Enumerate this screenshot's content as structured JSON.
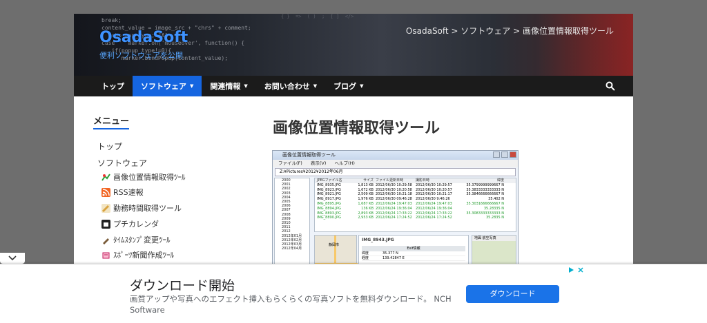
{
  "header": {
    "brand": "OsadaSoft",
    "tagline": "便利ソフトウェアを公開",
    "breadcrumb": "OsadaSoft > ソフトウェア > 画像位置情報取得ツール",
    "code_snippet": "break;\ncontent_value = image_src + \"chrs\" + comment;\n  echo map_type; \"A\"\ncase \"  marker.on('mouseover', function() {\n   if(popup_type!=0){\n      marker.bindPopup(content_value);"
  },
  "nav": {
    "items": [
      {
        "label": "トップ",
        "caret": ""
      },
      {
        "label": "ソフトウェア",
        "caret": "▼"
      },
      {
        "label": "関連情報",
        "caret": "▼"
      },
      {
        "label": "お問い合わせ",
        "caret": "▼"
      },
      {
        "label": "ブログ",
        "caret": "▼"
      }
    ]
  },
  "sidebar": {
    "title": "メニュー",
    "top_link": "トップ",
    "software_link": "ソフトウェア",
    "items": [
      {
        "label": "画像位置情報取得ﾂｰﾙ",
        "icon": "map-pin-icon",
        "color": "#2c9e3a"
      },
      {
        "label": "RSS速報",
        "icon": "rss-icon",
        "color": "#f26522"
      },
      {
        "label": "勤務時間取得ツール",
        "icon": "pencil-icon",
        "color": "#d9a441"
      },
      {
        "label": "プチカレンダ",
        "icon": "calendar-icon",
        "color": "#222222"
      },
      {
        "label": "ﾀｲﾑｽﾀﾝﾌﾟ変更ﾂｰﾙ",
        "icon": "pen-icon",
        "color": "#7a5c3a"
      },
      {
        "label": "ｽﾎﾟｰﾂ新聞作成ﾂｰﾙ",
        "icon": "newspaper-icon",
        "color": "#c2185b"
      }
    ]
  },
  "main": {
    "title": "画像位置情報取得ツール",
    "screenshot": {
      "window_title": "画像位置情報取得ツール",
      "menu": [
        "ファイル(F)",
        "表示(V)",
        "ヘルプ(H)"
      ],
      "path": "Z:¥Pictures¥2012¥2012年06月",
      "tree": [
        "2000",
        "2001",
        "2002",
        "2003",
        "2004",
        "2005",
        "2006",
        "2007",
        "2008",
        "2009",
        "2010",
        "2011",
        "2012",
        "2012年01月",
        "2012年02月",
        "2012年03月",
        "2012年04月"
      ],
      "columns": [
        "JPEGファイル名",
        "サイズ",
        "ファイル更新日時",
        "撮影日時",
        "緯度"
      ],
      "rows": [
        {
          "name": "IMG_8935.JPG",
          "size": "1,813 KB",
          "mtime": "2012/06/30 10:29:58",
          "shot": "2012/06/30 10:29:57",
          "lat": "35.3799999999667 N",
          "g": false
        },
        {
          "name": "IMG_8923.JPG",
          "size": "1,672 KB",
          "mtime": "2012/06/30 10:20:58",
          "shot": "2012/06/30 10:20:57",
          "lat": "35.3833333333333 N",
          "g": false
        },
        {
          "name": "IMG_8921.JPG",
          "size": "2,509 KB",
          "mtime": "2012/06/30 10:21:18",
          "shot": "2012/06/30 10:21:17",
          "lat": "35.3846666666667 N",
          "g": false
        },
        {
          "name": "IMG_8917.JPG",
          "size": "1,976 KB",
          "mtime": "2012/06/30 09:46:28",
          "shot": "2012/06/30 9:46:26",
          "lat": "35.402 N",
          "g": false
        },
        {
          "name": "IMG_8895.JPG",
          "size": "1,687 KB",
          "mtime": "2012/06/24 19:47:03",
          "shot": "2012/06/24 19:47:03",
          "lat": "35.3031666666667 N",
          "g": true
        },
        {
          "name": "IMG_8894.JPG",
          "size": "136 KB",
          "mtime": "2012/06/24 19:36:04",
          "shot": "2012/06/24 19:36:04",
          "lat": "35.28335 N",
          "g": true
        },
        {
          "name": "IMG_8893.JPG",
          "size": "2,893 KB",
          "mtime": "2012/06/24 17:33:22",
          "shot": "2012/06/24 17:33:22",
          "lat": "35.3083333333333 N",
          "g": true
        },
        {
          "name": "IMG_8890.JPG",
          "size": "2,953 KB",
          "mtime": "2012/06/24 17:24:52",
          "shot": "2012/06/24 17:24:52",
          "lat": "35.2835 N",
          "g": true
        }
      ],
      "exif_title": "IMG_8943.JPG",
      "exif_header": "Exif情報",
      "exif": [
        {
          "k": "緯度",
          "v": "35.377 N"
        },
        {
          "k": "経度",
          "v": "139.42847 E"
        }
      ],
      "map_tabs": "地図 航空写真",
      "map_label": "静岡市"
    }
  },
  "ad": {
    "title": "ダウンロード開始",
    "description": "画質アップや写真へのエフェクト挿入もらくらくの写真ソフトを無料ダウンロード。 NCH Software",
    "button": "ダウンロード"
  },
  "colors": {
    "accent": "#1565e0",
    "nav_bg": "#1b1b1b",
    "ad_button": "#1a73e8",
    "brand": "#3e92ff"
  }
}
